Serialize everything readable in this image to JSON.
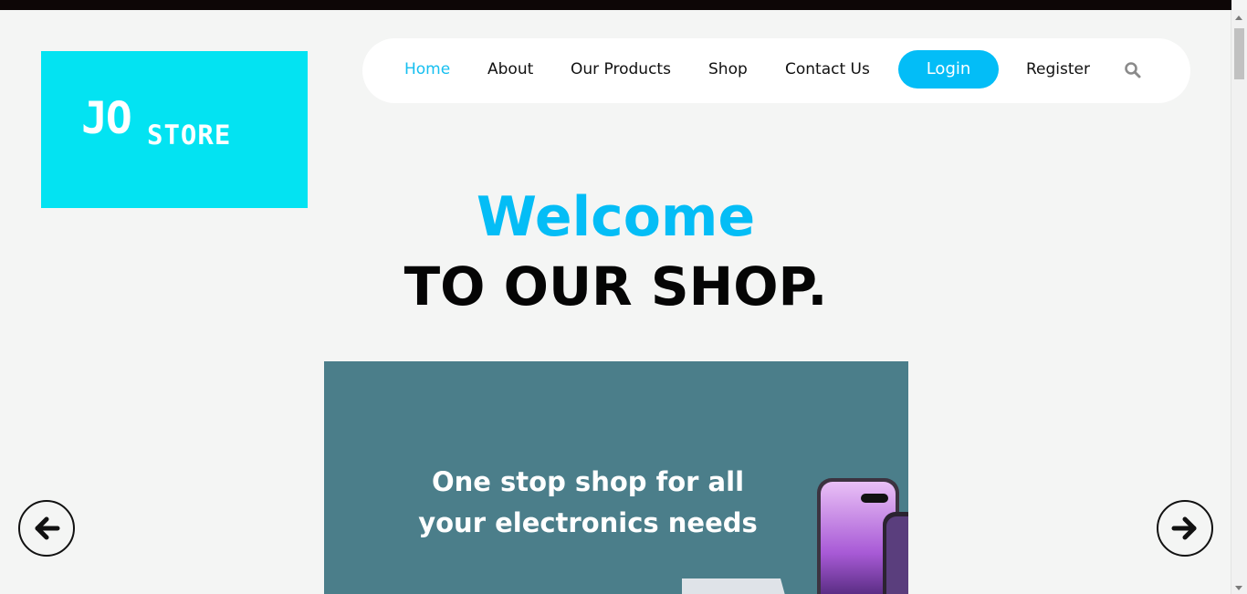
{
  "logo": {
    "text_top": "JO",
    "text_bottom": "STORE",
    "bg_color": "#03e3f2"
  },
  "nav": {
    "items": [
      {
        "label": "Home",
        "active": true
      },
      {
        "label": "About"
      },
      {
        "label": "Our Products"
      },
      {
        "label": "Shop"
      },
      {
        "label": "Contact Us"
      }
    ],
    "login_label": "Login",
    "register_label": "Register",
    "search_icon": "search-icon"
  },
  "hero": {
    "title": "Welcome",
    "subtitle": "TO OUR SHOP."
  },
  "banner": {
    "line1": "One stop shop for all",
    "line2": "your electronics needs",
    "bg_color": "#4b7e8a"
  },
  "carousel": {
    "prev_icon": "arrow-left-icon",
    "next_icon": "arrow-right-icon"
  },
  "colors": {
    "accent": "#03bdf7",
    "nav_active": "#16bff0",
    "top_bar": "#0d0606"
  }
}
